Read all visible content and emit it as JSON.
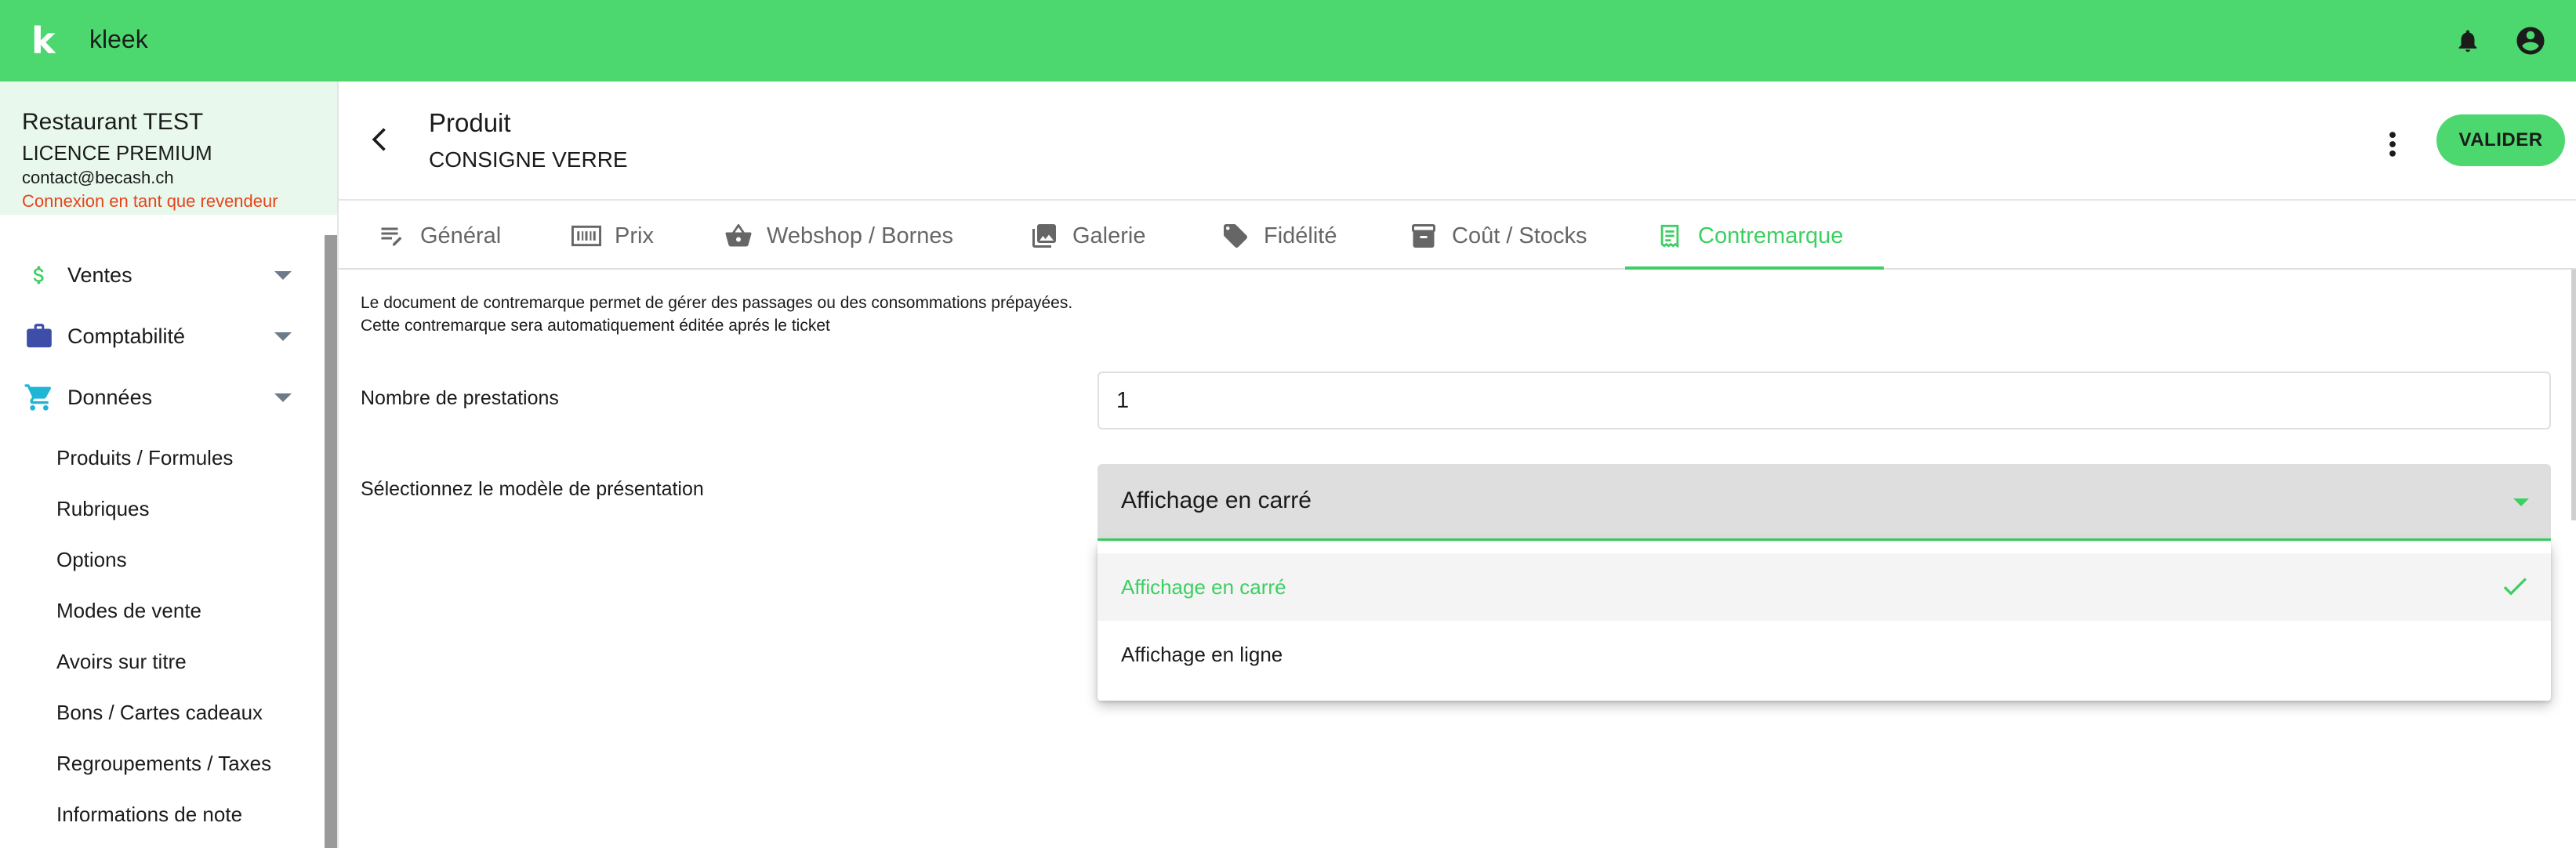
{
  "topbar": {
    "logo_letter": "k",
    "app_name": "kleek",
    "icons": [
      "bell-icon",
      "account-circle-icon"
    ]
  },
  "account": {
    "name": "Restaurant TEST",
    "licence": "LICENCE PREMIUM",
    "email": "contact@becash.ch",
    "reseller_link": "Connexion en tant que revendeur"
  },
  "sidebar": {
    "sections": [
      {
        "label": "Ventes",
        "icon": "dollar-icon"
      },
      {
        "label": "Comptabilité",
        "icon": "briefcase-icon"
      },
      {
        "label": "Données",
        "icon": "cart-icon"
      }
    ],
    "items": [
      "Produits / Formules",
      "Rubriques",
      "Options",
      "Modes de vente",
      "Avoirs sur titre",
      "Bons / Cartes cadeaux",
      "Regroupements / Taxes",
      "Informations de note"
    ]
  },
  "header": {
    "title": "Produit",
    "subtitle": "CONSIGNE VERRE",
    "validate_label": "VALIDER"
  },
  "tabs": [
    {
      "label": "Général",
      "icon": "edit-notes-icon"
    },
    {
      "label": "Prix",
      "icon": "barcode-icon"
    },
    {
      "label": "Webshop / Bornes",
      "icon": "basket-icon"
    },
    {
      "label": "Galerie",
      "icon": "image-gallery-icon"
    },
    {
      "label": "Fidélité",
      "icon": "tag-icon"
    },
    {
      "label": "Coût / Stocks",
      "icon": "archive-icon"
    },
    {
      "label": "Contremarque",
      "icon": "receipt-icon",
      "active": true
    }
  ],
  "content": {
    "description_line1": "Le document de contremarque permet de gérer des passages ou des consommations prépayées.",
    "description_line2": "Cette contremarque sera automatiquement éditée aprés le ticket",
    "prestations_label": "Nombre de prestations",
    "prestations_value": "1",
    "model_label": "Sélectionnez le modèle de présentation",
    "model_value": "Affichage en carré",
    "model_options": [
      "Affichage en carré",
      "Affichage en ligne"
    ]
  },
  "colors": {
    "brand_green": "#4cd86e",
    "active_green": "#3ccf62",
    "reseller_red": "#e8431c"
  }
}
